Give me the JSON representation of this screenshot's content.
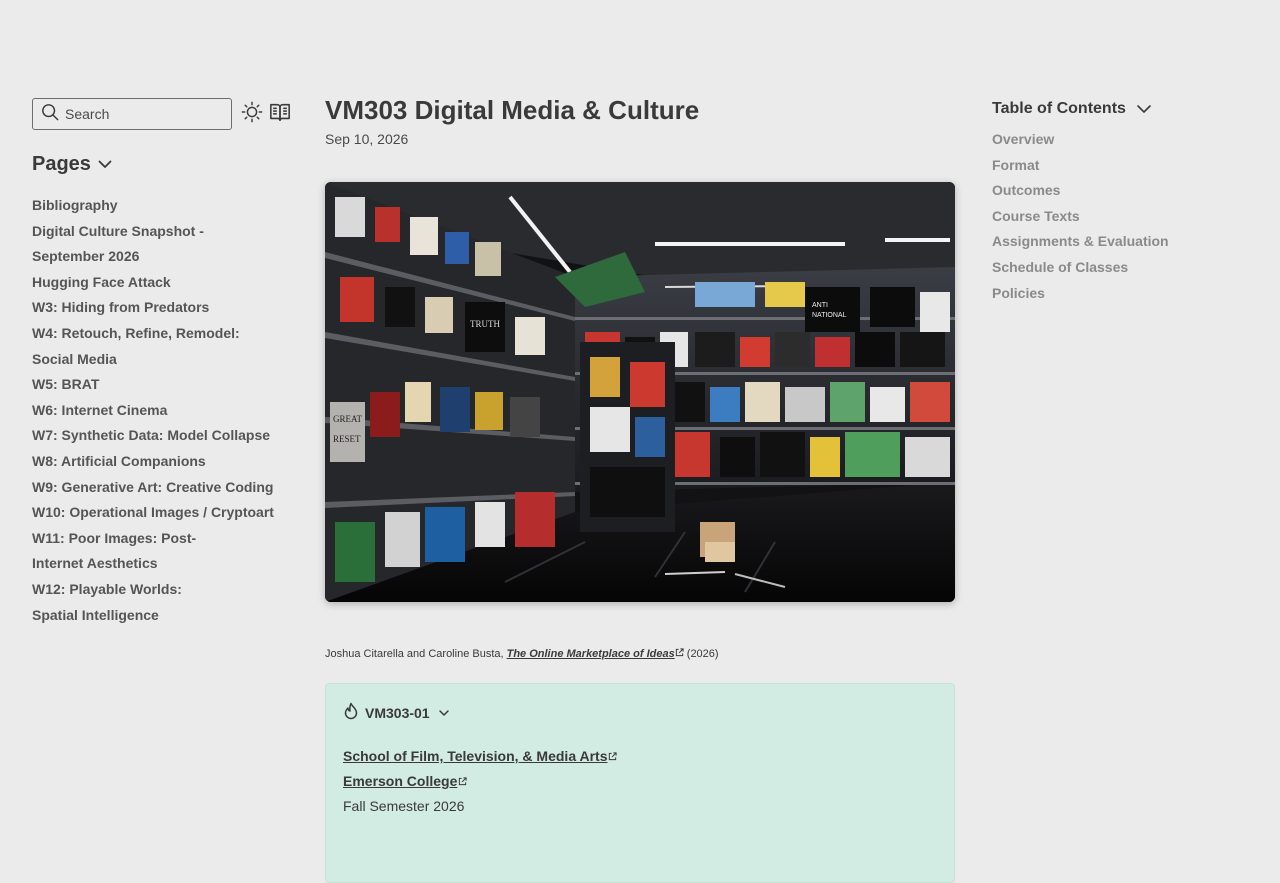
{
  "sidebar": {
    "search_placeholder": "Search",
    "pages_title": "Pages",
    "items": [
      "Bibliography",
      "Digital Culture Snapshot - September 2026",
      "Hugging Face Attack",
      "W3: Hiding from Predators",
      "W4: Retouch, Refine, Remodel: Social Media",
      "W5: BRAT",
      "W6: Internet Cinema",
      "W7: Synthetic Data: Model Collapse",
      "W8: Artificial Companions",
      "W9: Generative Art: Creative Coding",
      "W10: Operational Images / Cryptoart",
      "W11: Poor Images: Post-Internet Aesthetics",
      "W12: Playable Worlds: Spatial Intelligence"
    ]
  },
  "main": {
    "title": "VM303 Digital Media & Culture",
    "date": "Sep 10, 2026",
    "caption": {
      "authors": "Joshua Citarella and Caroline Busta, ",
      "link": "The Online Marketplace of Ideas",
      "year": " (2026)"
    },
    "callout": {
      "label": "VM303-01",
      "school_link": "School of Film, Television, & Media Arts",
      "college_link": "Emerson College",
      "semester": "Fall Semester 2026"
    }
  },
  "toc": {
    "title": "Table of Contents",
    "items": [
      "Overview",
      "Format",
      "Outcomes",
      "Course Texts",
      "Assignments & Evaluation",
      "Schedule of Classes",
      "Policies"
    ]
  },
  "icons": {
    "search": "search-icon",
    "theme": "sun-icon",
    "reader": "book-icon",
    "chevron": "chevron-down-icon",
    "flame": "flame-icon",
    "external": "external-link-icon"
  },
  "colors": {
    "background": "#ebebeb",
    "text": "#3a3a3a",
    "toc_text": "#8a8a8a",
    "callout_bg": "#d2ebe3"
  }
}
